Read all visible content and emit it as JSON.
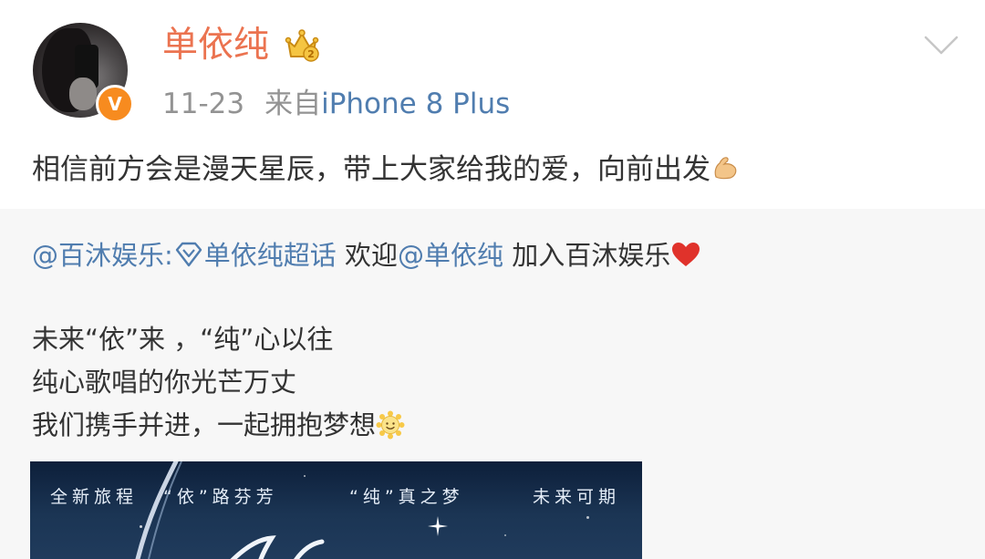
{
  "user": {
    "name": "单依纯",
    "vip_letter": "V",
    "avatar": "avatar-photo",
    "name_color": "#eb7350"
  },
  "meta": {
    "date": "11-23",
    "source_prefix": "来自",
    "source_device": "iPhone 8 Plus"
  },
  "post": {
    "text": "相信前方会是漫天星辰，带上大家给我的爱，向前出发",
    "emoji": "flexed-biceps"
  },
  "repost": {
    "author_link": "@百沐娱乐",
    "separator": ":",
    "topic_link": "单依纯超话",
    "welcome_text": " 欢迎",
    "mention_link": "@单依纯",
    "join_text": " 加入百沐娱乐",
    "heart_emoji": "red-heart",
    "lines": [
      "未来“依”来 ，“纯”心以往",
      "纯心歌唱的你光芒万丈",
      "我们携手并进，一起拥抱梦想"
    ],
    "sun_emoji": "smiling-sun",
    "image": {
      "texts": [
        "全新旅程",
        "“依”路芬芳",
        "“纯”真之梦",
        "未来可期"
      ]
    }
  },
  "colors": {
    "link": "#507daf",
    "muted": "#939393",
    "repost_bg": "#f7f7f7"
  },
  "icons": {
    "crown": "vip-crown-icon",
    "menu": "chevron-down-icon",
    "topic": "diamond-topic-icon"
  }
}
